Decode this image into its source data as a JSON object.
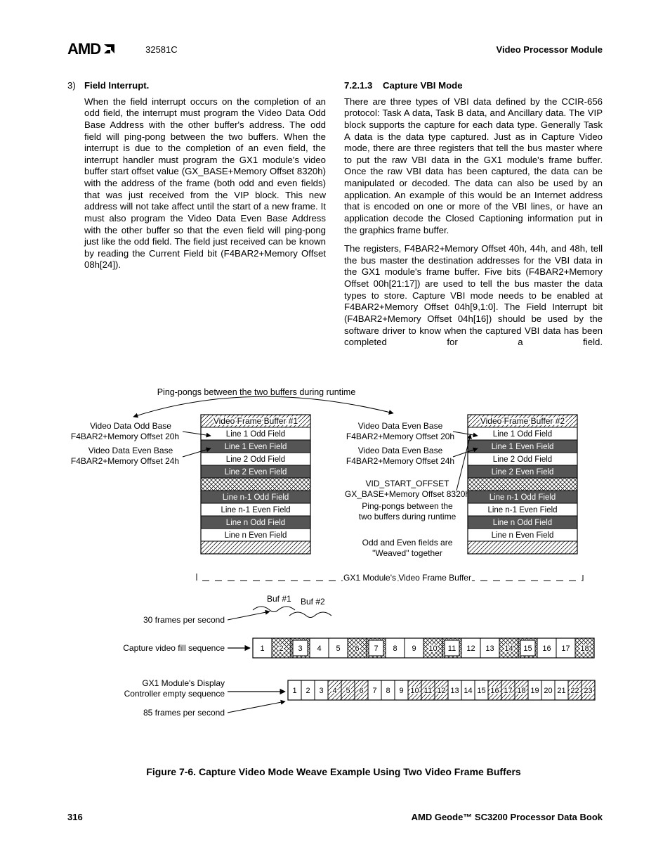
{
  "header": {
    "logo_text": "AMD",
    "docnum": "32581C",
    "right": "Video Processor Module"
  },
  "left_col": {
    "item_num": "3)",
    "item_title": "Field Interrupt.",
    "item_body": "When the field interrupt occurs on the completion of an odd field, the interrupt must program the Video Data Odd Base Address with the other buffer's address. The odd field will ping-pong between the two buffers. When the interrupt is due to the completion of an even field, the interrupt handler must program the GX1 module's video buffer start offset value (GX_BASE+Memory Offset 8320h) with the address of the frame (both odd and even fields) that was just received from the VIP block. This new address will not take affect until the start of a new frame. It must also program the Video Data Even Base Address with the other buffer so that the even field will ping-pong just like the odd field. The field just received can be known by reading the Current Field bit (F4BAR2+Memory Offset 08h[24])."
  },
  "right_col": {
    "heading_num": "7.2.1.3",
    "heading": "Capture VBI Mode",
    "p1": "There are three types of VBI data defined by the CCIR-656 protocol: Task A data, Task B data, and Ancillary data. The VIP block supports the capture for each data type. Generally Task A data is the data type captured. Just as in Capture Video mode, there are three registers that tell the bus master where to put the raw VBI data in the GX1 module's frame buffer. Once the raw VBI data has been captured, the data can be manipulated or decoded. The data can also be used by an application. An example of this would be an Internet address that is encoded on one or more of the VBI lines, or have an application decode the Closed Captioning information put in the graphics frame buffer.",
    "p2": "The registers, F4BAR2+Memory Offset 40h, 44h, and 48h, tell the bus master the destination addresses for the VBI data in the GX1 module's frame buffer. Five bits (F4BAR2+Memory Offset 00h[21:17]) are used to tell the bus master the data types to store. Capture VBI mode needs to be enabled at F4BAR2+Memory Offset 04h[9,1:0]. The Field Interrupt bit (F4BAR2+Memory Offset 04h[16]) should be used by the software driver to know when the captured VBI data has been completed for a field."
  },
  "fig": {
    "toplabel": "Ping-pongs between the two buffers during runtime",
    "left_labels": {
      "l1a": "Video Data Odd Base",
      "l1b": "F4BAR2+Memory Offset 20h",
      "l2a": "Video Data Even Base",
      "l2b": "F4BAR2+Memory Offset 24h"
    },
    "mid_labels": {
      "m1a": "Video Data Even Base",
      "m1b": "F4BAR2+Memory Offset 20h",
      "m2a": "Video Data Even Base",
      "m2b": "F4BAR2+Memory Offset 24h",
      "m3a": "VID_START_OFFSET",
      "m3b": "GX_BASE+Memory Offset 8320h",
      "m3c": "Ping-pongs between the",
      "m3d": "two buffers during runtime",
      "m4a": "Odd and Even fields are",
      "m4b": "\"Weaved\" together",
      "gx1": "GX1 Module's Video Frame Buffer"
    },
    "buf1_title": "Video Frame Buffer #1",
    "buf2_title": "Video Frame Buffer #2",
    "rows": [
      "Line 1 Odd Field",
      "Line 1 Even Field",
      "Line 2 Odd Field",
      "Line 2 Even Field",
      "",
      "Line n-1 Odd Field",
      "Line n-1 Even Field",
      "Line n Odd Field",
      "Line n Even Field"
    ],
    "buf1": "Buf #1",
    "buf2": "Buf #2",
    "fps30": "30 frames per second",
    "fps85": "85 frames per second",
    "cap_seq": "Capture video fill sequence",
    "disp_seq1": "GX1 Module's Display",
    "disp_seq2": "Controller empty sequence",
    "seq1": [
      "1",
      "2",
      "3",
      "4",
      "5",
      "6",
      "7",
      "8",
      "9",
      "10",
      "11",
      "12",
      "13",
      "14",
      "15",
      "16",
      "17",
      "18"
    ],
    "seq2": [
      "1",
      "2",
      "3",
      "4",
      "5",
      "6",
      "7",
      "8",
      "9",
      "10",
      "11",
      "12",
      "13",
      "14",
      "15",
      "16",
      "17",
      "18",
      "19",
      "20",
      "21",
      "22",
      "23"
    ],
    "caption": "Figure 7-6.  Capture Video Mode Weave Example Using Two Video Frame Buffers"
  },
  "footer": {
    "page": "316",
    "book": "AMD Geode™ SC3200 Processor Data Book"
  }
}
